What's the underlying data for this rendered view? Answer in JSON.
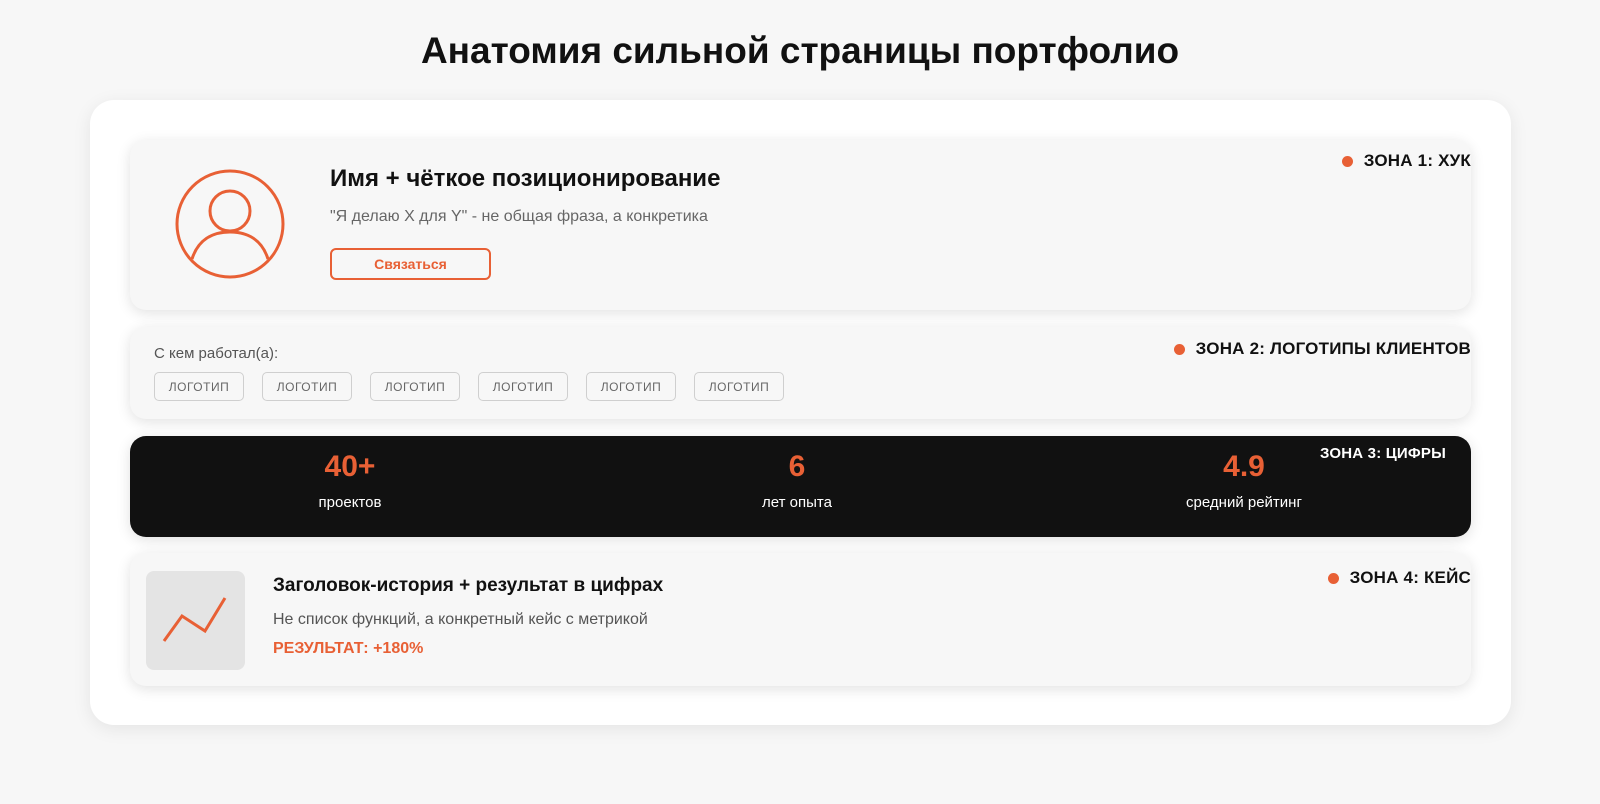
{
  "page": {
    "title": "Анатомия сильной страницы портфолио"
  },
  "colors": {
    "accent": "#e86035",
    "dark": "#111111",
    "background": "#f7f7f7"
  },
  "zone1": {
    "tag": "ЗОНА 1: ХУК",
    "avatar_icon": "user-avatar-icon",
    "name": "Имя + чёткое позиционирование",
    "tagline": "\"Я делаю X для Y\" - не общая фраза, а конкретика",
    "button_label": "Связаться"
  },
  "zone2": {
    "tag": "ЗОНА 2: ЛОГОТИПЫ КЛИЕНТОВ",
    "label": "С кем работал(а):",
    "logos": [
      "ЛОГОТИП",
      "ЛОГОТИП",
      "ЛОГОТИП",
      "ЛОГОТИП",
      "ЛОГОТИП",
      "ЛОГОТИП"
    ]
  },
  "zone3": {
    "tag": "ЗОНА 3: ЦИФРЫ",
    "stats": [
      {
        "value": "40+",
        "label": "проектов"
      },
      {
        "value": "6",
        "label": "лет опыта"
      },
      {
        "value": "4.9",
        "label": "средний рейтинг"
      }
    ]
  },
  "zone4": {
    "tag": "ЗОНА 4: КЕЙС",
    "thumb_icon": "trend-chart-icon",
    "headline": "Заголовок-история + результат в цифрах",
    "description": "Не список функций, а конкретный кейс с метрикой",
    "result": "РЕЗУЛЬТАТ: +180%"
  }
}
